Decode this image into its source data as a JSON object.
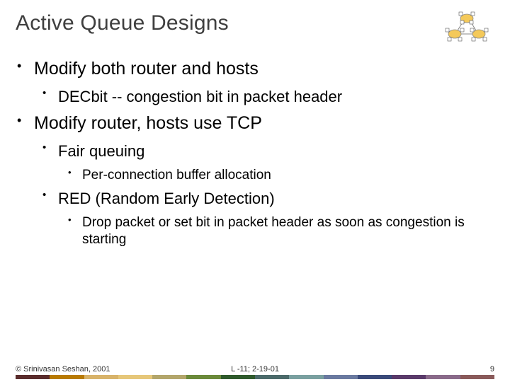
{
  "title": "Active Queue Designs",
  "bullets": {
    "b1": "Modify both router and hosts",
    "b1_1": "DECbit -- congestion bit in packet header",
    "b2": "Modify router, hosts use TCP",
    "b2_1": "Fair queuing",
    "b2_1_1": "Per-connection buffer allocation",
    "b2_2": "RED (Random Early Detection)",
    "b2_2_1": "Drop packet or set bit in packet header as soon as congestion is starting"
  },
  "footer": {
    "left": "© Srinivasan Seshan, 2001",
    "center": "L -11; 2-19-01",
    "right": "9"
  }
}
